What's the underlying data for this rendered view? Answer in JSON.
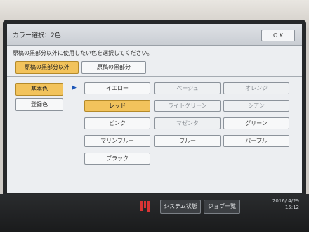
{
  "screen": {
    "title": "カラー選択：2色",
    "ok_label": "O K",
    "instruction": "原稿の黒部分以外に使用したい色を選択してください。"
  },
  "tabs": [
    {
      "label": "原稿の黒部分以外",
      "selected": true
    },
    {
      "label": "原稿の黒部分",
      "selected": false
    }
  ],
  "left_menu": [
    {
      "label": "基本色",
      "selected": true
    },
    {
      "label": "登録色",
      "selected": false
    }
  ],
  "arrow_glyph": "▶",
  "colors": [
    {
      "label": "イエロー",
      "state": "normal"
    },
    {
      "label": "ベージュ",
      "state": "disabled"
    },
    {
      "label": "オレンジ",
      "state": "disabled"
    },
    {
      "label": "レッド",
      "state": "selected"
    },
    {
      "label": "ライトグリーン",
      "state": "disabled"
    },
    {
      "label": "シアン",
      "state": "disabled"
    },
    {
      "label": "ピンク",
      "state": "normal"
    },
    {
      "label": "マゼンタ",
      "state": "disabled"
    },
    {
      "label": "グリーン",
      "state": "normal"
    },
    {
      "label": "マリンブルー",
      "state": "normal"
    },
    {
      "label": "ブルー",
      "state": "normal"
    },
    {
      "label": "パープル",
      "state": "normal"
    },
    {
      "label": "ブラック",
      "state": "normal"
    }
  ],
  "bottom": {
    "system_status_label": "システム状態",
    "job_list_label": "ジョブ一覧",
    "date": "2016/ 4/29",
    "time": "15:12"
  },
  "theme": {
    "selected_color": "#f2c35c",
    "accent_arrow": "#1d57b8"
  }
}
